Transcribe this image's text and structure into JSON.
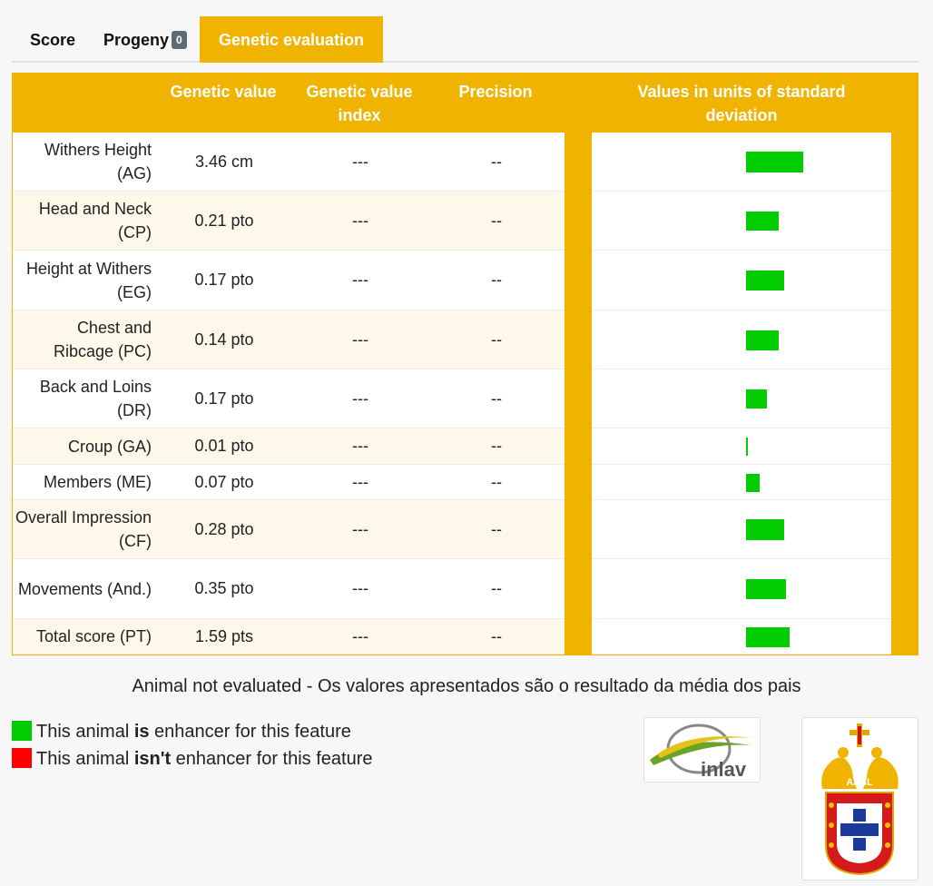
{
  "tabs": [
    {
      "label": "Score"
    },
    {
      "label": "Progeny",
      "badge": "0"
    },
    {
      "label": "Genetic evaluation",
      "active": true
    }
  ],
  "table": {
    "headers": {
      "genetic_value": "Genetic value",
      "genetic_value_index": "Genetic value index",
      "precision": "Precision",
      "sd_values": "Values in units of standard deviation"
    },
    "rows": [
      {
        "label": "Withers Height (AG)",
        "value": "3.46 cm",
        "index": "---",
        "precision": "--",
        "sd": 0.95
      },
      {
        "label": "Head and Neck (CP)",
        "value": "0.21 pto",
        "index": "---",
        "precision": "--",
        "sd": 0.55
      },
      {
        "label": "Height at Withers (EG)",
        "value": "0.17 pto",
        "index": "---",
        "precision": "--",
        "sd": 0.63
      },
      {
        "label": "Chest and Ribcage (PC)",
        "value": "0.14 pto",
        "index": "---",
        "precision": "--",
        "sd": 0.55
      },
      {
        "label": "Back and Loins (DR)",
        "value": "0.17 pto",
        "index": "---",
        "precision": "--",
        "sd": 0.35
      },
      {
        "label": "Croup (GA)",
        "value": "0.01 pto",
        "index": "---",
        "precision": "--",
        "sd": 0.03
      },
      {
        "label": "Members (ME)",
        "value": "0.07 pto",
        "index": "---",
        "precision": "--",
        "sd": 0.23
      },
      {
        "label": "Overall Impression (CF)",
        "value": "0.28 pto",
        "index": "---",
        "precision": "--",
        "sd": 0.63
      },
      {
        "label": "Movements (And.)",
        "value": "0.35 pto",
        "index": "---",
        "precision": "--",
        "sd": 0.66
      },
      {
        "label": "Total score (PT)",
        "value": "1.59 pts",
        "index": "---",
        "precision": "--",
        "sd": 0.72
      }
    ]
  },
  "note": "Animal not evaluated - Os valores apresentados são o resultado da média dos pais",
  "legend": {
    "enhancer": {
      "pre": "This animal ",
      "bold": "is",
      "post": " enhancer for this feature",
      "color": "#00cc00"
    },
    "not_enhancer": {
      "pre": "This animal ",
      "bold": "isn't",
      "post": " enhancer for this feature",
      "color": "#ff0000"
    }
  },
  "logos": {
    "inlav": "inlav",
    "apsl": "APSL"
  },
  "colors": {
    "accent": "#f0b400",
    "positive": "#00cc00",
    "negative": "#ff0000"
  }
}
